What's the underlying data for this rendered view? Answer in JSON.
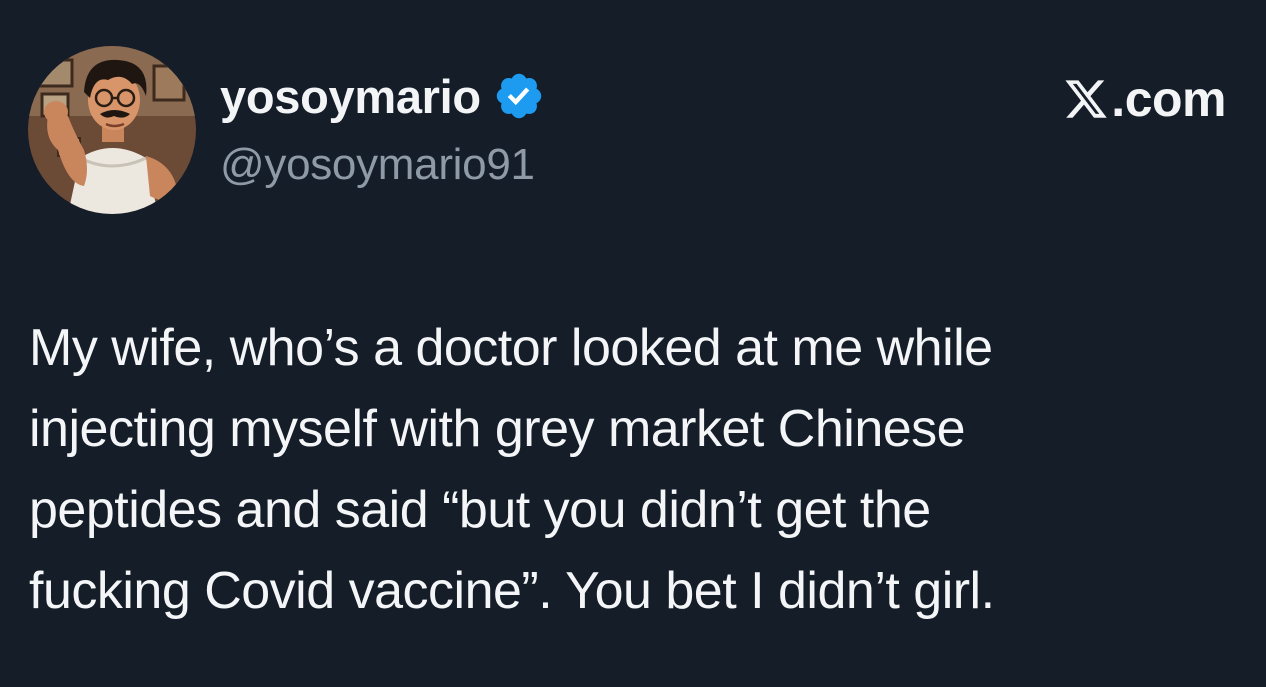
{
  "author": {
    "display_name": "yosoymario",
    "handle": "@yosoymario91",
    "verified": true,
    "verified_icon": "verified-badge-icon",
    "avatar": "avatar-illustration"
  },
  "brand": {
    "label": ".com",
    "icon": "x-logo-icon"
  },
  "tweet": {
    "lines": [
      "My wife, who’s a doctor looked at me while",
      "injecting myself with grey market Chinese",
      "peptides and said “but you didn’t get the",
      "fucking Covid vaccine”. You bet I didn’t girl."
    ]
  },
  "colors": {
    "background": "#151d29",
    "text_primary": "#f3f5f7",
    "text_secondary": "#8e9aa6",
    "verified_blue": "#1d9bf0"
  }
}
